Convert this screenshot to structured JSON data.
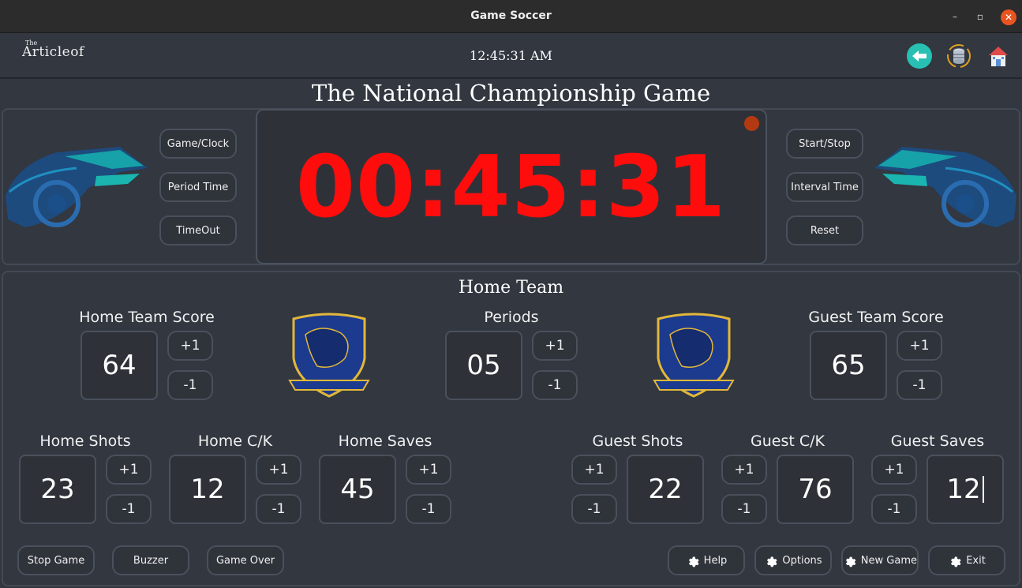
{
  "window": {
    "title": "Game Soccer",
    "minimize": "–",
    "maximize": "▫",
    "close": "✕"
  },
  "header": {
    "logo_small": "The",
    "logo_big": "Articleof",
    "time": "12:45:31 AM"
  },
  "game_title": "The National Championship Game",
  "clock": {
    "display": "00:45:31"
  },
  "left_controls": [
    "Game/Clock",
    "Period Time",
    "TimeOut"
  ],
  "right_controls": [
    "Start/Stop",
    "Interval Time",
    "Reset"
  ],
  "section_title": "Home Team",
  "scores": {
    "home": {
      "label": "Home Team Score",
      "value": "64"
    },
    "periods": {
      "label": "Periods",
      "value": "05"
    },
    "guest": {
      "label": "Guest Team Score",
      "value": "65"
    }
  },
  "stats": {
    "home_shots": {
      "label": "Home Shots",
      "value": "23"
    },
    "home_ck": {
      "label": "Home C/K",
      "value": "12"
    },
    "home_saves": {
      "label": "Home Saves",
      "value": "45"
    },
    "guest_shots": {
      "label": "Guest Shots",
      "value": "22"
    },
    "guest_ck": {
      "label": "Guest C/K",
      "value": "76"
    },
    "guest_saves": {
      "label": "Guest Saves",
      "value": "12"
    }
  },
  "inc_label": "+1",
  "dec_label": "-1",
  "footer_left": [
    "Stop Game",
    "Buzzer",
    "Game Over"
  ],
  "footer_right": [
    "Help",
    "Options",
    "New Game",
    "Exit"
  ],
  "icons": {
    "back": "back-arrow-icon",
    "database": "database-sync-icon",
    "home": "home-icon",
    "gear": "gear-icon"
  },
  "colors": {
    "clock_red": "#ff0d0d",
    "accent_teal": "#27c0b3",
    "crest_blue": "#1c3a8e",
    "crest_gold": "#e2b73a"
  }
}
